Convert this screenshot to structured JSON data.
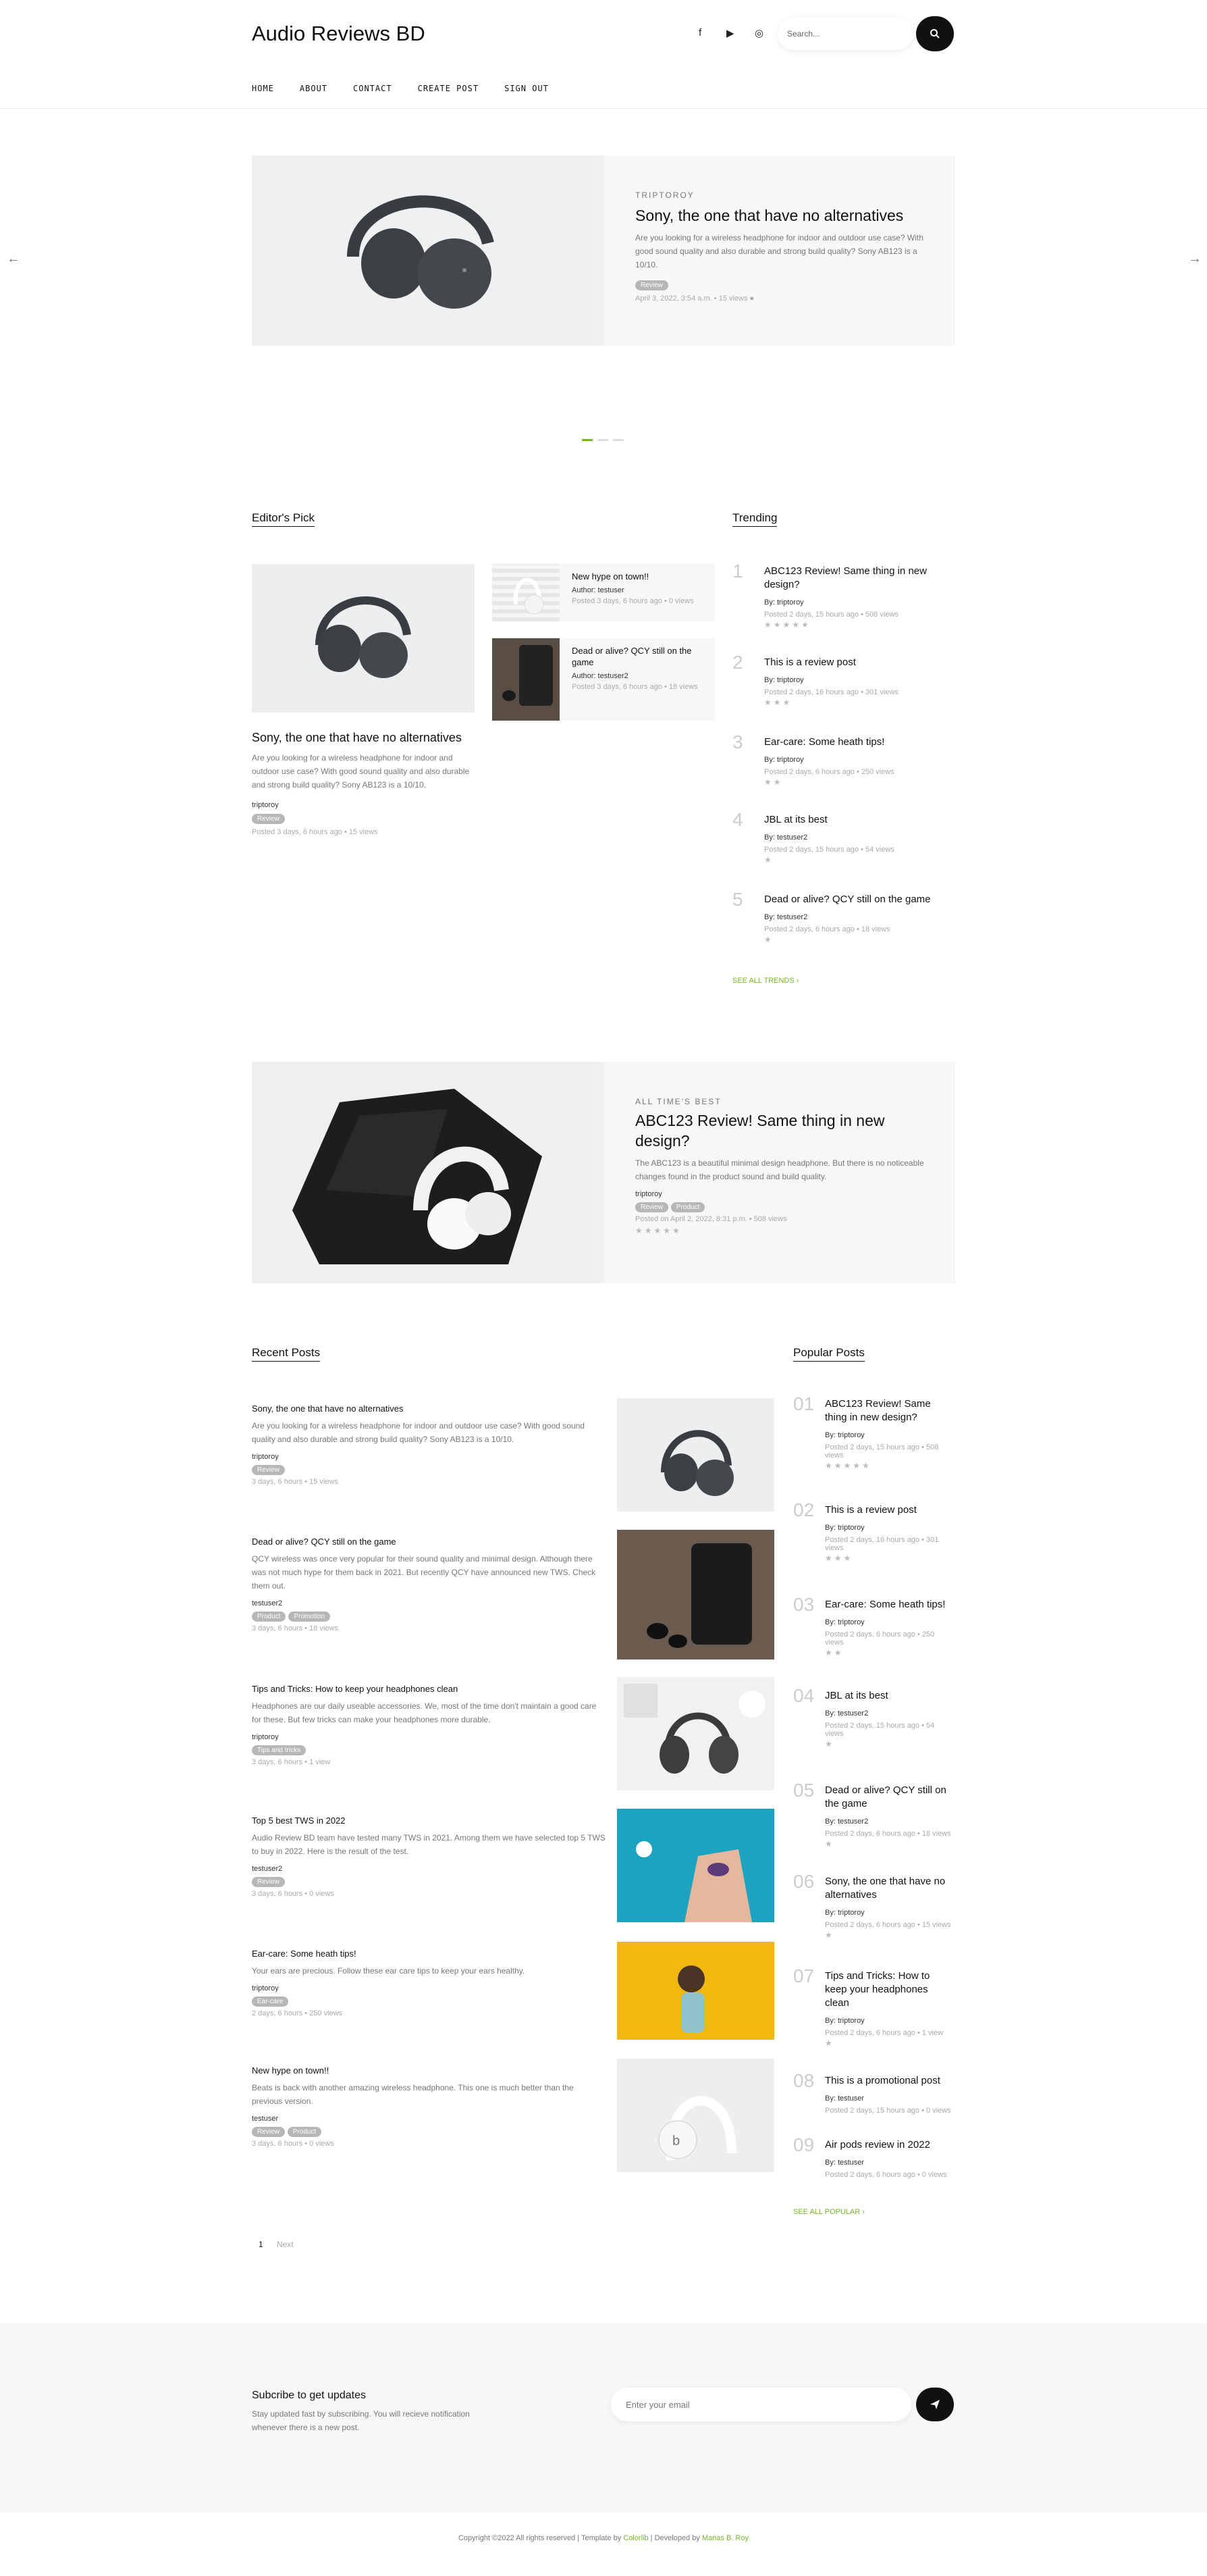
{
  "header": {
    "site_title": "Audio Reviews BD",
    "search_placeholder": "Search...",
    "social_icons": [
      "facebook-icon",
      "youtube-icon",
      "instagram-icon"
    ]
  },
  "nav": {
    "items": [
      "HOME",
      "ABOUT",
      "CONTACT",
      "CREATE POST",
      "SIGN OUT"
    ]
  },
  "hero": {
    "category": "TRIPTOROY",
    "title": "Sony, the one that have no alternatives",
    "excerpt": "Are you looking for a wireless headphone for indoor and outdoor use case? With good sound quality and also durable and strong build quality? Sony AB123 is a 10/10.",
    "badge": "Review",
    "meta": "April 3, 2022, 3:54 a.m.  •  15 views  ●"
  },
  "editors_pick": {
    "title": "Editor's Pick",
    "main": {
      "title": "Sony, the one that have no alternatives",
      "excerpt": "Are you looking for a wireless headphone for indoor and outdoor use case? With good sound quality and also durable and strong build quality? Sony AB123 is a 10/10.",
      "author": "triptoroy",
      "badge": "Review",
      "meta": "Posted 3 days, 6 hours ago  •  15 views"
    },
    "side": [
      {
        "title": "New hype on town!!",
        "author": "Author: testuser",
        "meta": "Posted 3 days, 6 hours ago  •  0 views"
      },
      {
        "title": "Dead or alive? QCY still on the game",
        "author": "Author: testuser2",
        "meta": "Posted 3 days, 6 hours ago  •  18 views"
      }
    ]
  },
  "trending": {
    "title": "Trending",
    "items": [
      {
        "num": "1",
        "title": "ABC123 Review! Same thing in new design?",
        "by": "By: triptoroy",
        "meta": "Posted 2 days, 15 hours ago  •  508 views",
        "stars": "★★★★★"
      },
      {
        "num": "2",
        "title": "This is a review post",
        "by": "By: triptoroy",
        "meta": "Posted 2 days, 16 hours ago  •  301 views",
        "stars": "★★★"
      },
      {
        "num": "3",
        "title": "Ear-care: Some heath tips!",
        "by": "By: triptoroy",
        "meta": "Posted 2 days, 6 hours ago  •  250 views",
        "stars": "★★"
      },
      {
        "num": "4",
        "title": "JBL at its best",
        "by": "By: testuser2",
        "meta": "Posted 2 days, 15 hours ago  •  54 views",
        "stars": "★"
      },
      {
        "num": "5",
        "title": "Dead or alive? QCY still on the game",
        "by": "By: testuser2",
        "meta": "Posted 2 days, 6 hours ago  •  18 views",
        "stars": "★"
      }
    ],
    "see_all": "SEE ALL TRENDS  ›"
  },
  "best": {
    "category": "ALL TIME'S BEST",
    "title": "ABC123 Review! Same thing in new design?",
    "excerpt": "The ABC123 is a beautiful minimal design headphone. But there is no noticeable changes found in the product sound and build quality.",
    "author": "triptoroy",
    "badges": [
      "Review",
      "Product"
    ],
    "meta": "Posted on April 2, 2022, 8:31 p.m.  •  508 views",
    "stars": "★★★★★"
  },
  "recent": {
    "title": "Recent Posts",
    "items": [
      {
        "title": "Sony, the one that have no alternatives",
        "excerpt": "Are you looking for a wireless headphone for indoor and outdoor use case? With good sound quality and also durable and strong build quality? Sony AB123 is a 10/10.",
        "author": "triptoroy",
        "badges": [
          "Review"
        ],
        "meta": "3 days, 6 hours  •  15 views"
      },
      {
        "title": "Dead or alive? QCY still on the game",
        "excerpt": "QCY wireless was once very popular for their sound quality and minimal design. Although there was not much hype for them back in 2021. But recently QCY have announced new TWS. Check them out.",
        "author": "testuser2",
        "badges": [
          "Product",
          "Promotion"
        ],
        "meta": "3 days, 6 hours  •  18 views"
      },
      {
        "title": "Tips and Tricks: How to keep your headphones clean",
        "excerpt": "Headphones are our daily useable accessories. We, most of the time don't maintain a good care for these. But few tricks can make your headphones more durable.",
        "author": "triptoroy",
        "badges": [
          "Tips and tricks"
        ],
        "meta": "3 days, 6 hours  •  1 view"
      },
      {
        "title": "Top 5 best TWS in 2022",
        "excerpt": "Audio Review BD team have tested many TWS in 2021. Among them we have selected top 5 TWS to buy in 2022. Here is the result of the test.",
        "author": "testuser2",
        "badges": [
          "Review"
        ],
        "meta": "3 days, 6 hours  •  0 views"
      },
      {
        "title": "Ear-care: Some heath tips!",
        "excerpt": "Your ears are precious. Follow these ear care tips to keep your ears healthy.",
        "author": "triptoroy",
        "badges": [
          "Ear-care"
        ],
        "meta": "2 days, 6 hours  •  250 views"
      },
      {
        "title": "New hype on town!!",
        "excerpt": "Beats is back with another amazing wireless headphone. This one is much better than the previous version.",
        "author": "testuser",
        "badges": [
          "Review",
          "Product"
        ],
        "meta": "3 days, 6 hours  •  0 views"
      }
    ],
    "pagination": {
      "current": "1",
      "next": "Next"
    }
  },
  "popular": {
    "title": "Popular Posts",
    "items": [
      {
        "num": "01",
        "title": "ABC123 Review! Same thing in new design?",
        "by": "By: triptoroy",
        "meta": "Posted 2 days, 15 hours ago  •  508 views",
        "stars": "★★★★★"
      },
      {
        "num": "02",
        "title": "This is a review post",
        "by": "By: triptoroy",
        "meta": "Posted 2 days, 16 hours ago  •  301 views",
        "stars": "★★★"
      },
      {
        "num": "03",
        "title": "Ear-care: Some heath tips!",
        "by": "By: triptoroy",
        "meta": "Posted 2 days, 6 hours ago  •  250 views",
        "stars": "★★"
      },
      {
        "num": "04",
        "title": "JBL at its best",
        "by": "By: testuser2",
        "meta": "Posted 2 days, 15 hours ago  •  54 views",
        "stars": "★"
      },
      {
        "num": "05",
        "title": "Dead or alive? QCY still on the game",
        "by": "By: testuser2",
        "meta": "Posted 2 days, 6 hours ago  •  18 views",
        "stars": "★"
      },
      {
        "num": "06",
        "title": "Sony, the one that have no alternatives",
        "by": "By: triptoroy",
        "meta": "Posted 2 days, 6 hours ago  •  15 views",
        "stars": "★"
      },
      {
        "num": "07",
        "title": "Tips and Tricks: How to keep your headphones clean",
        "by": "By: triptoroy",
        "meta": "Posted 2 days, 6 hours ago  •  1 view",
        "stars": "★"
      },
      {
        "num": "08",
        "title": "This is a promotional post",
        "by": "By: testuser",
        "meta": "Posted 2 days, 15 hours ago  •  0 views",
        "stars": ""
      },
      {
        "num": "09",
        "title": "Air pods review in 2022",
        "by": "By: testuser",
        "meta": "Posted 2 days, 6 hours ago  •  0 views",
        "stars": ""
      }
    ],
    "see_all": "SEE ALL POPULAR  ›"
  },
  "subscribe": {
    "title": "Subcribe to get updates",
    "text": "Stay updated fast by subscribing. You will recieve notification whenever there is a new post.",
    "placeholder": "Enter your email"
  },
  "footer": {
    "copyright": "Copyright ©2022 All rights reserved | Template by ",
    "template_by": "Colorlib",
    "sep": " | Developed by ",
    "developer": "Manas B. Roy"
  },
  "colors": {
    "accent": "#72b626",
    "dark": "#111111",
    "light_bg": "#f6f7f8"
  }
}
